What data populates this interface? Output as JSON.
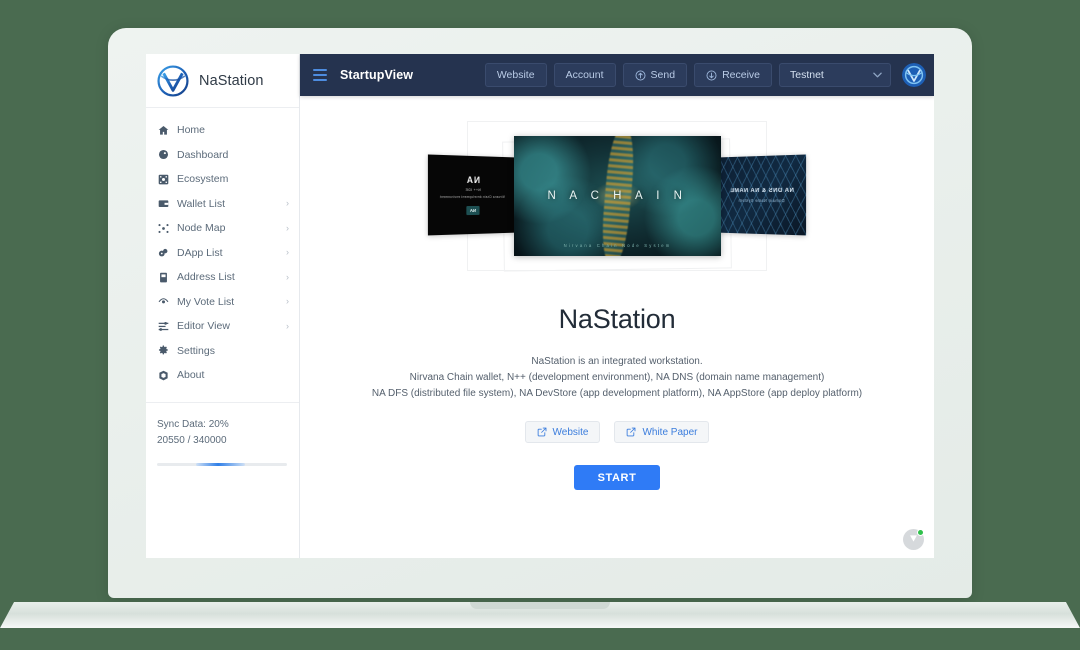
{
  "window": {
    "background_color": "#4a6b50",
    "device_color": "#eef3f0"
  },
  "sidebar": {
    "brand": {
      "name": "NaStation",
      "logo_icon": "nastation-logo-icon"
    },
    "items": [
      {
        "label": "Home",
        "icon": "home-icon",
        "chevron": ""
      },
      {
        "label": "Dashboard",
        "icon": "dashboard-icon",
        "chevron": ""
      },
      {
        "label": "Ecosystem",
        "icon": "ecosystem-icon",
        "chevron": ""
      },
      {
        "label": "Wallet List",
        "icon": "wallet-icon",
        "chevron": "›"
      },
      {
        "label": "Node Map",
        "icon": "node-map-icon",
        "chevron": "›"
      },
      {
        "label": "DApp List",
        "icon": "dapp-icon",
        "chevron": "›"
      },
      {
        "label": "Address List",
        "icon": "address-book-icon",
        "chevron": "›"
      },
      {
        "label": "My Vote List",
        "icon": "vote-icon",
        "chevron": "›"
      },
      {
        "label": "Editor View",
        "icon": "editor-icon",
        "chevron": "›"
      },
      {
        "label": "Settings",
        "icon": "gear-icon",
        "chevron": ""
      },
      {
        "label": "About",
        "icon": "about-icon",
        "chevron": ""
      }
    ],
    "sync": {
      "status_label": "Sync Data: 20%",
      "blocks_label": "20550 / 340000",
      "percent": 20,
      "current_blocks": 20550,
      "total_blocks": 340000,
      "bar_color": "#2f7fe8"
    }
  },
  "topbar": {
    "background_color": "#25334f",
    "menu_icon": "hamburger-icon",
    "title": "StartupView",
    "actions": [
      {
        "label": "Website",
        "icon": ""
      },
      {
        "label": "Account",
        "icon": ""
      },
      {
        "label": "Send",
        "icon": "arrow-up-circle-icon"
      },
      {
        "label": "Receive",
        "icon": "arrow-down-circle-icon"
      }
    ],
    "network": {
      "selected": "Testnet",
      "caret": "⌄"
    },
    "avatar_icon": "user-avatar-icon"
  },
  "carousel": {
    "center": {
      "title": "N A   C H A I N",
      "subtitle": "Nirvana Chain Node System"
    },
    "left": {
      "line1": "NA",
      "line2": "N++ IDE",
      "line3": "Nirvana Chain development environment",
      "badge": "NA"
    },
    "right": {
      "line1": "NA DNS & NA NAME",
      "line2": "Domain Name System"
    }
  },
  "main": {
    "headline": "NaStation",
    "description_lines": [
      "NaStation is an integrated workstation.",
      "Nirvana Chain wallet, N++ (development environment), NA DNS (domain name management)",
      "NA DFS (distributed file system), NA DevStore (app development platform), NA AppStore (app deploy platform)"
    ],
    "links": [
      {
        "label": "Website",
        "icon": "external-link-icon"
      },
      {
        "label": "White Paper",
        "icon": "external-link-icon"
      }
    ],
    "start_button": {
      "label": "START",
      "color": "#2f7bf6"
    },
    "status_badge": {
      "icon": "shield-status-icon",
      "dot_color": "#2fc04b"
    }
  }
}
